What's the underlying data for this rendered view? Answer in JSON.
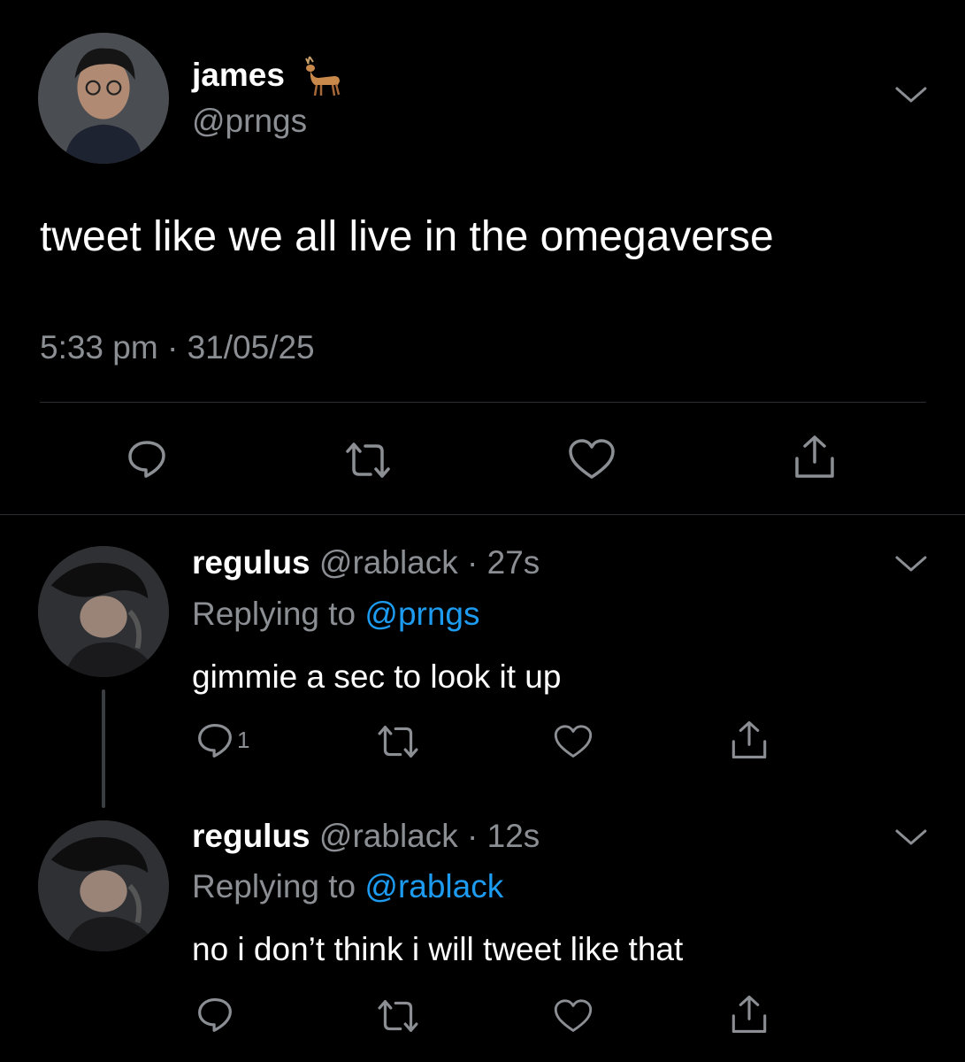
{
  "main_tweet": {
    "display_name": "james",
    "handle": "@prngs",
    "name_emoji": "🦌",
    "text": "tweet like we all live in the omegaverse",
    "time": "5:33 pm · 31/05/25"
  },
  "replies": [
    {
      "display_name": "regulus",
      "handle": "@rablack",
      "age": "· 27s",
      "replying_label": "Replying to",
      "replying_to": "@prngs",
      "text": "gimmie a sec to look it up",
      "reply_count": "1"
    },
    {
      "display_name": "regulus",
      "handle": "@rablack",
      "age": "· 12s",
      "replying_label": "Replying to",
      "replying_to": "@rablack",
      "text": "no i don’t think i will tweet like that",
      "reply_count": ""
    }
  ],
  "colors": {
    "background": "#000000",
    "text": "#ffffff",
    "muted": "#8b8f94",
    "link": "#1d9bf0",
    "divider": "#2a2d31"
  },
  "icons": [
    "chevron-down-icon",
    "reply-icon",
    "retweet-icon",
    "like-icon",
    "share-icon",
    "deer-emoji"
  ]
}
